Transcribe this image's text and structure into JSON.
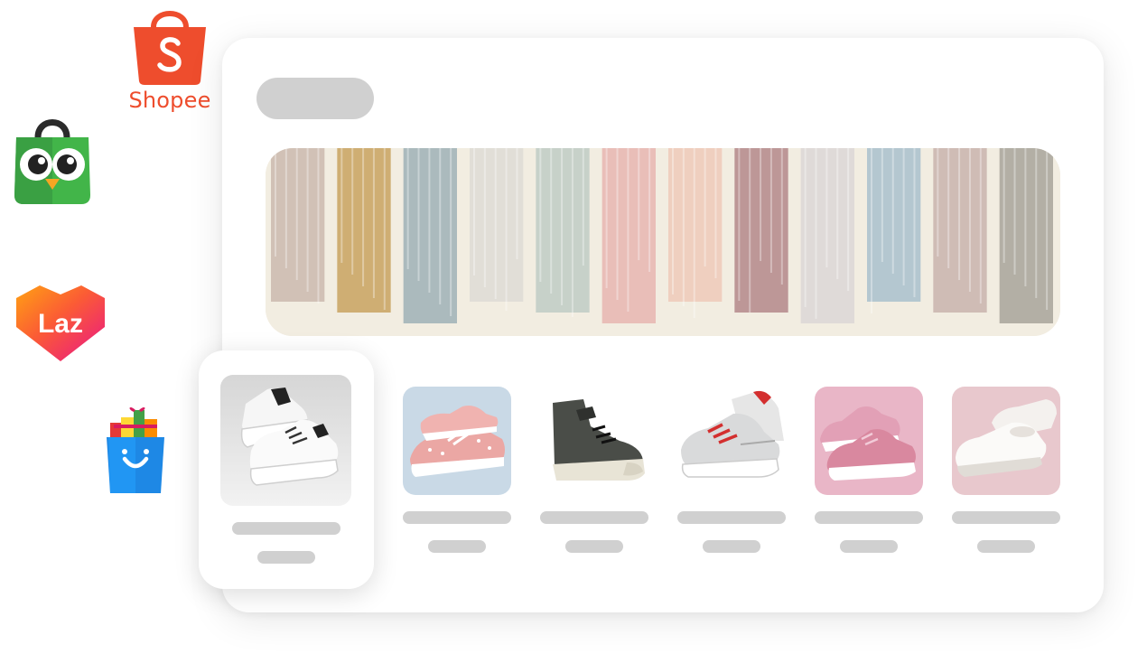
{
  "marketplaces": {
    "shopee": {
      "name": "Shopee",
      "icon": "shopee-bag-icon",
      "color": "#ee4d2d"
    },
    "tokopedia": {
      "icon": "tokopedia-owl-icon",
      "color": "#42b549"
    },
    "lazada": {
      "name": "Laz",
      "icon": "lazada-heart-icon",
      "color": "#f5318b"
    },
    "bukalapak": {
      "icon": "gift-bag-icon",
      "color": "#1e88e5"
    }
  },
  "storefront": {
    "title_placeholder": "",
    "banner": {
      "icon": "pastel-paint-swatches-banner"
    },
    "featured_product": {
      "icon": "white-sneaker-image"
    },
    "products": [
      {
        "icon": "pink-dotted-sneaker-image"
      },
      {
        "icon": "black-high-top-sneaker-image"
      },
      {
        "icon": "white-red-running-shoe-image"
      },
      {
        "icon": "pink-knit-sneaker-image"
      },
      {
        "icon": "white-slip-on-shoe-image"
      }
    ]
  },
  "colors": {
    "skeleton": "#d0d0d0",
    "card_background": "#ffffff"
  }
}
